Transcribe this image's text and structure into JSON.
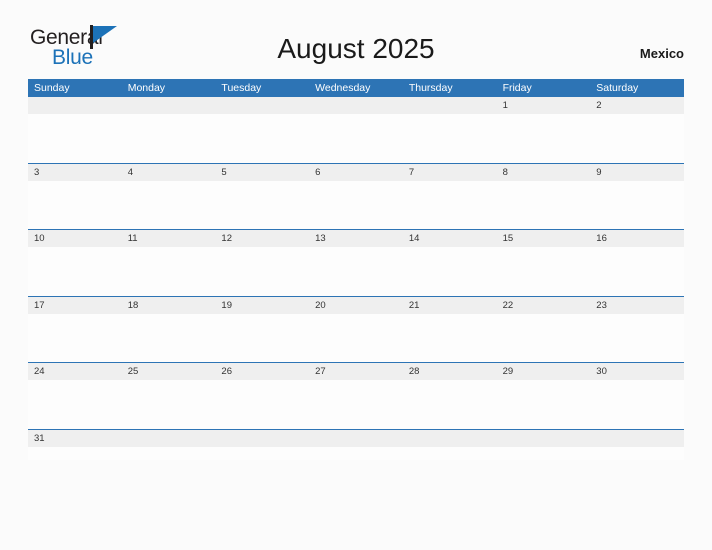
{
  "brand": {
    "name_part1": "General",
    "name_part2": "Blue",
    "flag_icon": "flag-icon"
  },
  "header": {
    "title": "August 2025",
    "country": "Mexico"
  },
  "calendar": {
    "month": "August",
    "year": "2025",
    "weekday_headers": [
      "Sunday",
      "Monday",
      "Tuesday",
      "Wednesday",
      "Thursday",
      "Friday",
      "Saturday"
    ],
    "accent_color": "#2d74b5",
    "date_band_color": "#efefef",
    "weeks": [
      {
        "dates": [
          "",
          "",
          "",
          "",
          "",
          "1",
          "2"
        ]
      },
      {
        "dates": [
          "3",
          "4",
          "5",
          "6",
          "7",
          "8",
          "9"
        ]
      },
      {
        "dates": [
          "10",
          "11",
          "12",
          "13",
          "14",
          "15",
          "16"
        ]
      },
      {
        "dates": [
          "17",
          "18",
          "19",
          "20",
          "21",
          "22",
          "23"
        ]
      },
      {
        "dates": [
          "24",
          "25",
          "26",
          "27",
          "28",
          "29",
          "30"
        ]
      },
      {
        "dates": [
          "31",
          "",
          "",
          "",
          "",
          "",
          ""
        ]
      }
    ]
  }
}
